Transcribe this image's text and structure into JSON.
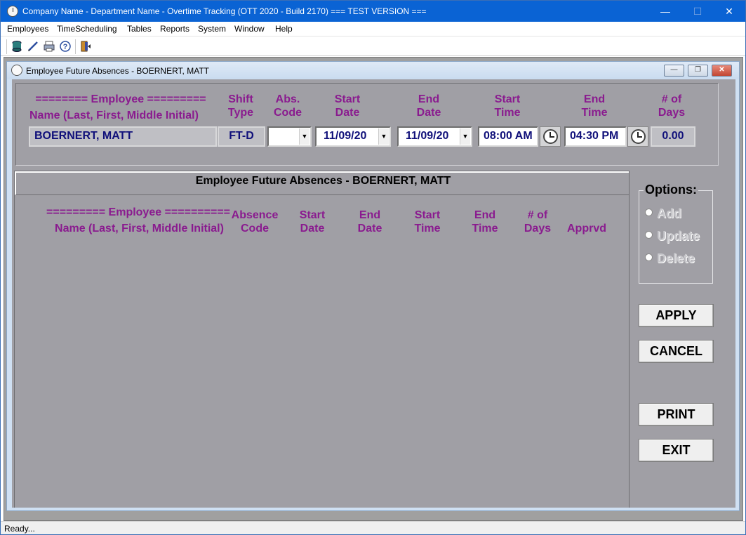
{
  "window": {
    "title": "Company Name - Department Name - Overtime Tracking (OTT 2020 - Build 2170)  === TEST VERSION ===",
    "min_glyph": "—",
    "max_glyph": "☐",
    "close_glyph": "✕"
  },
  "menu": [
    "Employees",
    "TimeScheduling",
    "Tables",
    "Reports",
    "System",
    "Window",
    "Help"
  ],
  "toolbar": {
    "icons": [
      "database-icon",
      "edit-icon",
      "print-icon",
      "help-icon",
      "exit-icon"
    ]
  },
  "child": {
    "title": "Employee Future Absences - BOERNERT, MATT",
    "min_glyph": "—",
    "restore_glyph": "❐",
    "close_glyph": "✕"
  },
  "entry": {
    "headers": {
      "employee_line1": "======== Employee =========",
      "employee_line2": "Name (Last, First, Middle Initial)",
      "shift_1": "Shift",
      "shift_2": "Type",
      "abs_1": "Abs.",
      "abs_2": "Code",
      "sdate_1": "Start",
      "sdate_2": "Date",
      "edate_1": "End",
      "edate_2": "Date",
      "stime_1": "Start",
      "stime_2": "Time",
      "etime_1": "End",
      "etime_2": "Time",
      "days_1": "# of",
      "days_2": "Days"
    },
    "values": {
      "employee": "BOERNERT, MATT",
      "shift_type": "FT-D",
      "abs_code": "",
      "start_date": "11/09/20",
      "end_date": "11/09/20",
      "start_time": "08:00 AM",
      "end_time": "04:30 PM",
      "days": "0.00"
    },
    "dropdown_glyph": "▼"
  },
  "list": {
    "title": "Employee Future Absences - BOERNERT, MATT",
    "headers": {
      "employee_line1": "========= Employee ==========",
      "employee_line2": "Name (Last, First, Middle Initial)",
      "abs_1": "Absence",
      "abs_2": "Code",
      "sdate_1": "Start",
      "sdate_2": "Date",
      "edate_1": "End",
      "edate_2": "Date",
      "stime_1": "Start",
      "stime_2": "Time",
      "etime_1": "End",
      "etime_2": "Time",
      "days_1": "# of",
      "days_2": "Days",
      "apprvd": "Apprvd"
    },
    "rows": []
  },
  "options": {
    "title": "Options:",
    "items": [
      "Add",
      "Update",
      "Delete"
    ]
  },
  "buttons": {
    "apply": "APPLY",
    "cancel": "CANCEL",
    "print": "PRINT",
    "exit": "EXIT"
  },
  "status": "Ready..."
}
